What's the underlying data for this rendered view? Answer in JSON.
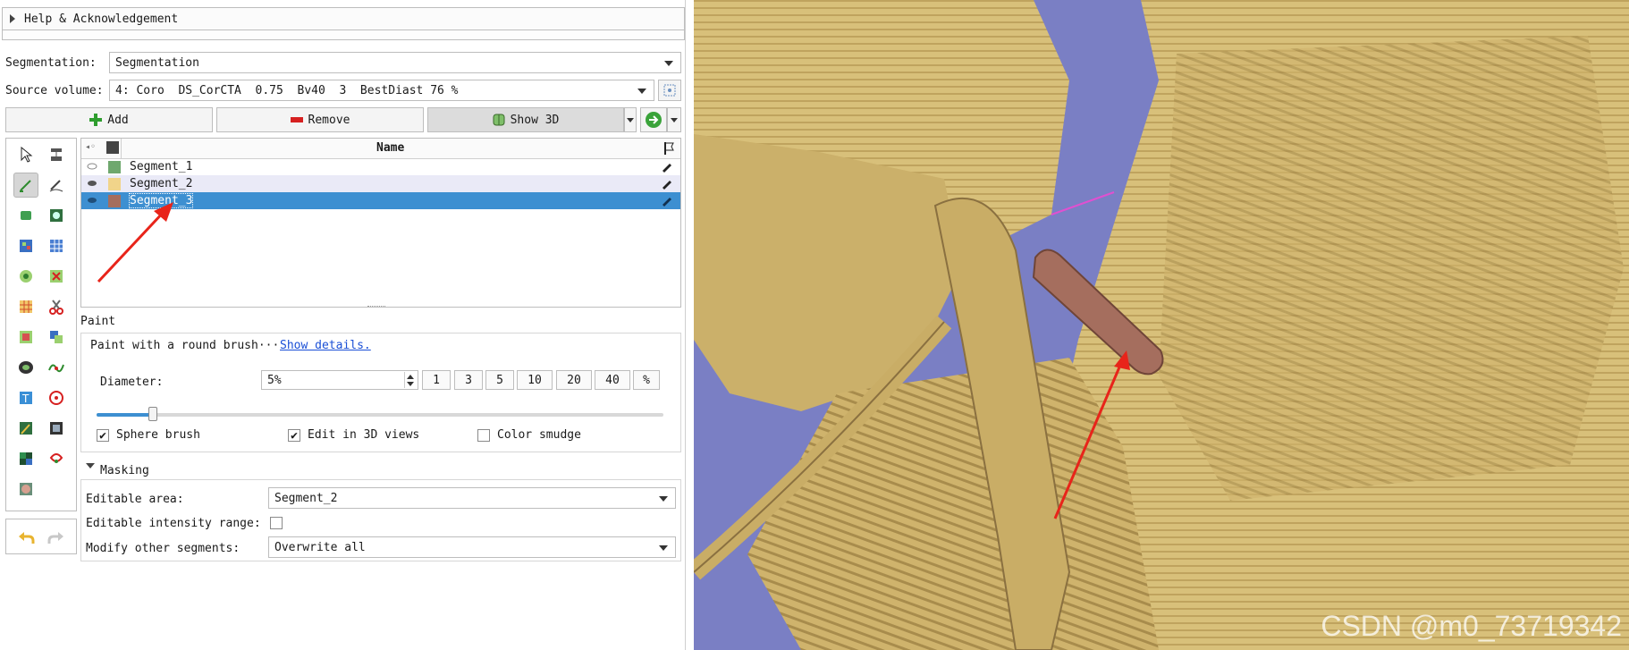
{
  "help": {
    "label": "Help & Acknowledgement"
  },
  "segmentation": {
    "label": "Segmentation:",
    "value": "Segmentation"
  },
  "source_volume": {
    "label": "Source volume:",
    "value": "4: Coro  DS_CorCTA  0.75  Bv40  3  BestDiast 76 %"
  },
  "buttons": {
    "add": "Add",
    "remove": "Remove",
    "show3d": "Show 3D"
  },
  "table": {
    "header_name": "Name",
    "rows": [
      {
        "name": "Segment_1",
        "color": "#6fa86e"
      },
      {
        "name": "Segment_2",
        "color": "#f1d48a"
      },
      {
        "name": "Segment_3",
        "color": "#a56e5e"
      }
    ]
  },
  "paint": {
    "title": "Paint",
    "description": "Paint with a round brush···",
    "show_details": "Show details.",
    "diameter_label": "Diameter:",
    "diameter_value": "5%",
    "presets": [
      "1",
      "3",
      "5",
      "10",
      "20",
      "40",
      "%"
    ],
    "slider_level": 0.1,
    "sphere_brush": "Sphere brush",
    "edit_3d": "Edit in 3D views",
    "color_smudge": "Color smudge",
    "sphere_checked": true,
    "edit3d_checked": true,
    "smudge_checked": false
  },
  "masking": {
    "title": "Masking",
    "editable_area_label": "Editable area:",
    "editable_area_value": "Segment_2",
    "intensity_label": "Editable intensity range:",
    "modify_label": "Modify other segments:",
    "modify_value": "Overwrite all"
  },
  "view": {
    "watermark": "CSDN @m0_73719342"
  },
  "colors": {
    "selection": "#3d8fd1",
    "bone": "#d8c07a",
    "vessel": "#a56e5e",
    "background": "#7a7fc4",
    "arrow": "#e8241a"
  }
}
